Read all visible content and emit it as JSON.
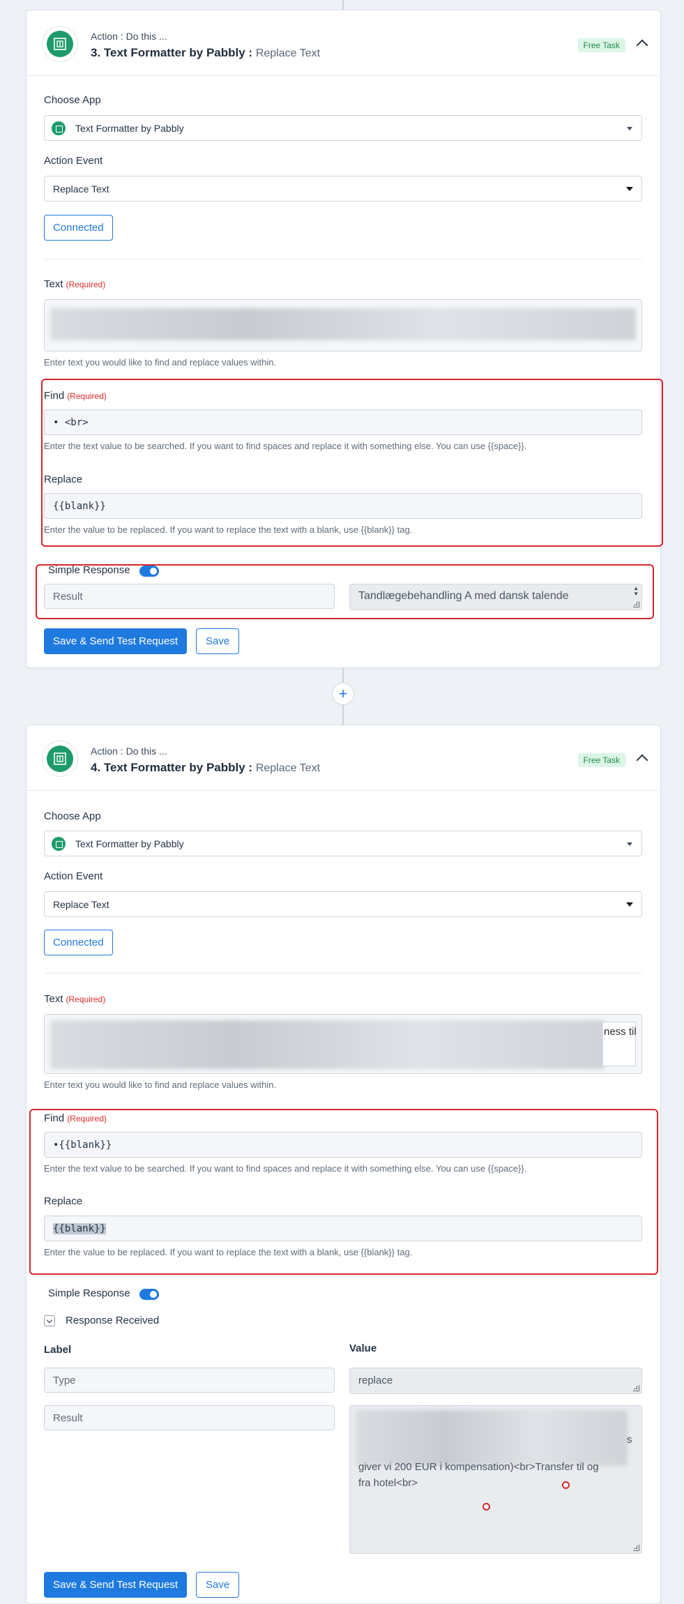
{
  "step3": {
    "action_label": "Action : Do this ...",
    "title": "3. Text Formatter by Pabbly :",
    "event_name": "Replace Text",
    "badge": "Free Task",
    "choose_app_label": "Choose App",
    "app_name": "Text Formatter by Pabbly",
    "action_event_label": "Action Event",
    "action_event_value": "Replace Text",
    "connected_label": "Connected",
    "text_label": "Text",
    "required": "(Required)",
    "text_help": "Enter text you would like to find and replace values within.",
    "find_label": "Find",
    "find_value": "• <br>",
    "find_help": "Enter the text value to be searched. If you want to find spaces and replace it with something else. You can use {{space}}.",
    "replace_label": "Replace",
    "replace_value": "{{blank}}",
    "replace_help": "Enter the value to be replaced. If you want to replace the text with a blank, use {{blank}} tag.",
    "simple_response_label": "Simple Response",
    "result_label": "Result",
    "result_value": "Tandlægebehandling A med dansk talende",
    "save_send_label": "Save & Send Test Request",
    "save_label": "Save"
  },
  "step4": {
    "action_label": "Action : Do this ...",
    "title": "4. Text Formatter by Pabbly :",
    "event_name": "Replace Text",
    "badge": "Free Task",
    "choose_app_label": "Choose App",
    "app_name": "Text Formatter by Pabbly",
    "action_event_label": "Action Event",
    "action_event_value": "Replace Text",
    "connected_label": "Connected",
    "text_label": "Text",
    "required": "(Required)",
    "text_visible_fragment": "ness til",
    "text_help": "Enter text you would like to find and replace values within.",
    "find_label": "Find",
    "find_value": "•{{blank}}",
    "find_help": "Enter the text value to be searched. If you want to find spaces and replace it with something else. You can use {{space}}.",
    "replace_label": "Replace",
    "replace_value": "{{blank}}",
    "replace_help": "Enter the value to be replaced. If you want to replace the text with a blank, use {{blank}} tag.",
    "simple_response_label": "Simple Response",
    "response_received_label": "Response Received",
    "col_label": "Label",
    "col_value": "Value",
    "type_label": "Type",
    "type_value": "replace",
    "result_label": "Result",
    "result_fragment_s": "s",
    "result_line1": "giver vi 200 EUR i kompensation)<br>Transfer til og",
    "result_line2": "fra hotel<br>",
    "save_send_label": "Save & Send Test Request",
    "save_label": "Save"
  },
  "colors": {
    "primary": "#1f7ae0",
    "app_green": "#1e9b6a",
    "highlight_red": "#d9252b",
    "badge_bg": "#dcf6e6",
    "badge_text": "#1f8a4c"
  },
  "icons": {
    "app": "text-formatter-icon",
    "plus": "plus-icon",
    "collapse": "chevron-up-icon"
  }
}
